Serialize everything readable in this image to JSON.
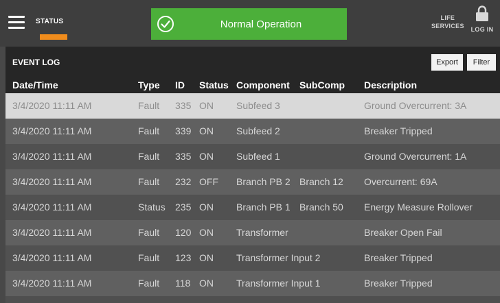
{
  "topbar": {
    "status_tab": "STATUS",
    "operation_status": "Normal Operation",
    "life_services": [
      "LIFE",
      "SERVICES"
    ],
    "login_label": "LOG IN",
    "accent_color": "#f08c1c",
    "ok_color": "#4caf3a"
  },
  "event_log": {
    "title": "EVENT LOG",
    "export_label": "Export",
    "filter_label": "Filter",
    "columns": [
      "Date/Time",
      "Type",
      "ID",
      "Status",
      "Component",
      "SubComp",
      "Description"
    ],
    "rows": [
      {
        "datetime": "3/4/2020 11:11 AM",
        "type": "Fault",
        "id": "335",
        "status": "ON",
        "component": "Subfeed 3",
        "subcomp": "",
        "description": "Ground Overcurrent: 3A"
      },
      {
        "datetime": "3/4/2020 11:11 AM",
        "type": "Fault",
        "id": "339",
        "status": "ON",
        "component": "Subfeed 2",
        "subcomp": "",
        "description": "Breaker Tripped"
      },
      {
        "datetime": "3/4/2020 11:11 AM",
        "type": "Fault",
        "id": "335",
        "status": "ON",
        "component": "Subfeed 1",
        "subcomp": "",
        "description": "Ground Overcurrent: 1A"
      },
      {
        "datetime": "3/4/2020 11:11 AM",
        "type": "Fault",
        "id": "232",
        "status": "OFF",
        "component": "Branch PB 2",
        "subcomp": "Branch 12",
        "description": "Overcurrent: 69A"
      },
      {
        "datetime": "3/4/2020 11:11 AM",
        "type": "Status",
        "id": "235",
        "status": "ON",
        "component": "Branch PB 1",
        "subcomp": "Branch 50",
        "description": "Energy Measure Rollover"
      },
      {
        "datetime": "3/4/2020 11:11 AM",
        "type": "Fault",
        "id": "120",
        "status": "ON",
        "component": "Transformer",
        "subcomp": "",
        "description": "Breaker Open Fail"
      },
      {
        "datetime": "3/4/2020 11:11 AM",
        "type": "Fault",
        "id": "123",
        "status": "ON",
        "component": "Transformer Input 2",
        "subcomp": "",
        "description": "Breaker Tripped"
      },
      {
        "datetime": "3/4/2020 11:11 AM",
        "type": "Fault",
        "id": "118",
        "status": "ON",
        "component": "Transformer Input 1",
        "subcomp": "",
        "description": "Breaker Tripped"
      }
    ]
  }
}
